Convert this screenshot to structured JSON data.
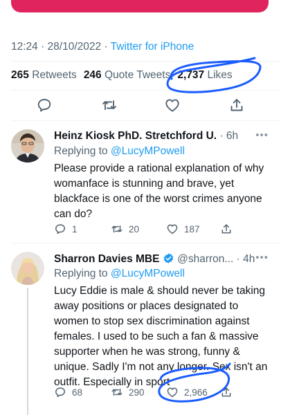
{
  "main_tweet": {
    "timestamp": "12:24 · 28/10/2022 · ",
    "source": "Twitter for iPhone",
    "retweets_count": "265",
    "retweets_label": "Retweets",
    "quotes_count": "246",
    "quotes_label": "Quote Tweets",
    "likes_count": "2,737",
    "likes_label": "Likes"
  },
  "replies": [
    {
      "name": "Heinz Kiosk PhD. Stretchford U.",
      "handle": "",
      "time": "· 6h",
      "replying_prefix": "Replying to ",
      "replying_to": "@LucyMPowell",
      "text": "Please provide a rational explanation of why womanface is stunning and brave, yet blackface is one of the worst crimes anyone can do?",
      "reply_count": "1",
      "retweet_count": "20",
      "like_count": "187"
    },
    {
      "name": "Sharron Davies MBE",
      "handle": "@sharron...",
      "time": "· 4h",
      "replying_prefix": "Replying to ",
      "replying_to": "@LucyMPowell",
      "text": "Lucy Eddie is male & should never be taking away positions or places designated to women to stop sex discrimination against females. I used to be such a fan & massive supporter when he was strong, funny & unique. Sadly I'm not any longer. Sex isn't an outfit. Especially in sport",
      "reply_count": "68",
      "retweet_count": "290",
      "like_count": "2,966"
    }
  ],
  "colors": {
    "accent": "#1d9bf0",
    "text": "#0f1419",
    "muted": "#536471",
    "annotation": "#1a5cff",
    "verified": "#1d9bf0"
  },
  "icons": {
    "reply": "reply-icon",
    "retweet": "retweet-icon",
    "like": "like-icon",
    "share": "share-icon",
    "more": "more-icon",
    "verified": "verified-badge-icon"
  }
}
